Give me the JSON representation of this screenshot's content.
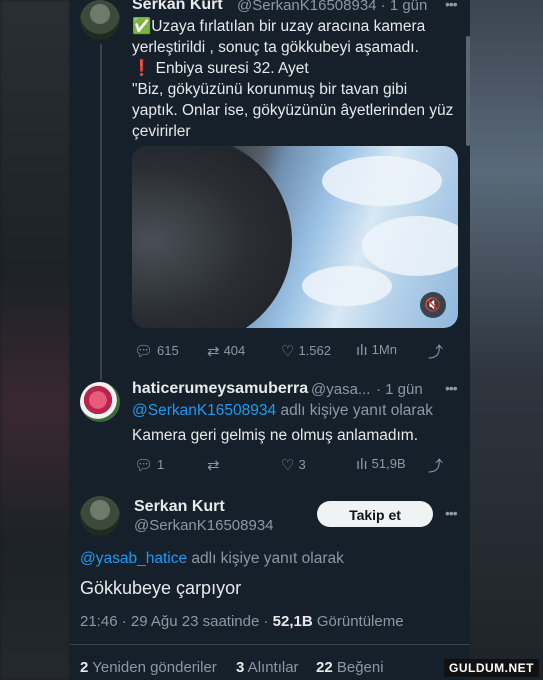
{
  "tweet_main": {
    "author_name": "Serkan Kurt",
    "author_handle": "@SerkanK16508934 · 1 gün",
    "lines": [
      "✅Uzaya fırlatılan bir uzay aracına kamera",
      "yerleştirildi , sonuç ta gökkubeyi aşamadı.",
      "❗ Enbiya suresi 32. Ayet",
      "\"Biz, gökyüzünü korunmuş bir tavan gibi",
      "yaptık. Onlar ise, gökyüzünün âyetlerinden yüz",
      "çevirirler"
    ],
    "actions": {
      "replies": "615",
      "retweets": "404",
      "likes": "1.562",
      "views": "1Mn"
    }
  },
  "reply": {
    "author_name": "haticerumeysamuberra",
    "author_handle": "@yasa...",
    "time": "· 1 gün",
    "reply_to_handle": "@SerkanK16508934",
    "reply_to_suffix": " adlı kişiye yanıt olarak",
    "text": "Kamera geri gelmiş ne olmuş anlamadım.",
    "actions": {
      "replies": "1",
      "retweets": "",
      "likes": "3",
      "views": "51,9B"
    }
  },
  "focus_tweet": {
    "author_name": "Serkan Kurt",
    "author_handle": "@SerkanK16508934",
    "follow_label": "Takip et",
    "reply_to_handle": "@yasab_hatice",
    "reply_to_suffix": " adlı kişiye yanıt olarak",
    "text": "Gökkubeye çarpıyor",
    "meta_prefix": "21:46 · 29 Ağu 23 saatinde · ",
    "meta_views": "52,1B",
    "meta_suffix": " Görüntüleme",
    "stats": [
      {
        "count": "2",
        "label": " Yeniden gönderiler"
      },
      {
        "count": "3",
        "label": " Alıntılar"
      },
      {
        "count": "22",
        "label": " Beğeni"
      }
    ]
  },
  "watermark": "GULDUM.NET",
  "colors": {
    "background": "#15202b",
    "link": "#1d9bf0",
    "muted": "#8b98a5",
    "text": "#e7e9ea"
  }
}
